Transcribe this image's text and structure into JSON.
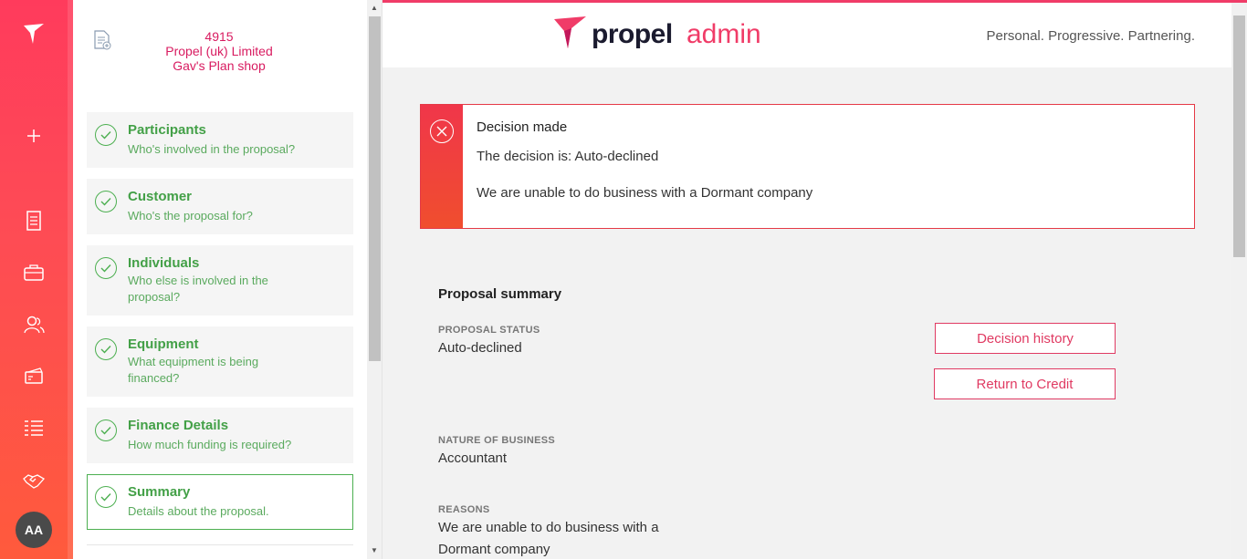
{
  "rail": {
    "icons": [
      "brand-logo-icon",
      "add-icon",
      "document-icon",
      "briefcase-icon",
      "users-icon",
      "card-icon",
      "list-icon",
      "handshake-icon"
    ],
    "avatar_initials": "AA"
  },
  "proposal": {
    "id": "4915",
    "company": "Propel (uk) Limited",
    "shop": "Gav's Plan shop"
  },
  "steps": [
    {
      "title": "Participants",
      "subtitle": "Who's involved in the proposal?"
    },
    {
      "title": "Customer",
      "subtitle": "Who's the proposal for?"
    },
    {
      "title": "Individuals",
      "subtitle": "Who else is involved in the proposal?"
    },
    {
      "title": "Equipment",
      "subtitle": "What equipment is being financed?"
    },
    {
      "title": "Finance Details",
      "subtitle": "How much funding is required?"
    },
    {
      "title": "Summary",
      "subtitle": "Details about the proposal."
    }
  ],
  "header": {
    "logo_word1": "propel",
    "logo_word2": "admin",
    "tagline": "Personal. Progressive. Partnering."
  },
  "alert": {
    "title": "Decision made",
    "decision": "The decision is: Auto-declined",
    "message": "We are unable to do business with a Dormant company"
  },
  "summary": {
    "title": "Proposal summary",
    "status_label": "PROPOSAL STATUS",
    "status_value": "Auto-declined",
    "nature_label": "NATURE OF BUSINESS",
    "nature_value": "Accountant",
    "reasons_label": "REASONS",
    "reasons_value": "We are unable to do business with a Dormant company"
  },
  "buttons": {
    "decision_history": "Decision history",
    "return_to_credit": "Return to Credit"
  },
  "colors": {
    "accent": "#f03c68",
    "success": "#4caf50",
    "error": "#e53946"
  }
}
